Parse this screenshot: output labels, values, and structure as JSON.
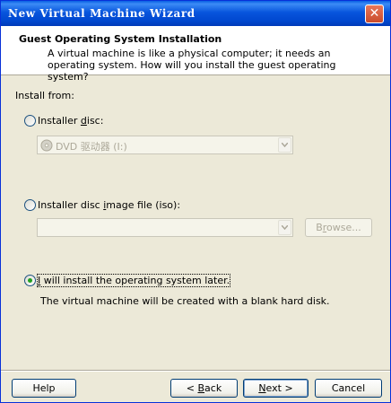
{
  "window": {
    "title": "New Virtual Machine Wizard",
    "close_glyph": "✕"
  },
  "header": {
    "title": "Guest Operating System Installation",
    "description": "A virtual machine is like a physical computer; it needs an operating system. How will you install the guest operating system?"
  },
  "install_from": {
    "label": "Install from:",
    "options": [
      {
        "label_pre": "Installer ",
        "label_key": "d",
        "label_post": "isc:",
        "selected": false,
        "combo_value": "DVD 驱动器 (I:)",
        "combo_icon": "dvd-drive-icon"
      },
      {
        "label_pre": "Installer disc ",
        "label_key": "i",
        "label_post": "mage file (iso):",
        "selected": false,
        "combo_value": "",
        "browse_pre": "B",
        "browse_key": "r",
        "browse_post": "owse..."
      },
      {
        "label_pre": "",
        "label_key": "I",
        "label_post": " will install the operating system later.",
        "selected": true,
        "info": "The virtual machine will be created with a blank hard disk."
      }
    ]
  },
  "buttons": {
    "help": "Help",
    "back_pre": "< ",
    "back_key": "B",
    "back_post": "ack",
    "next_key": "N",
    "next_post": "ext >",
    "cancel": "Cancel"
  },
  "colors": {
    "titlebar": "#0855dd",
    "radio_dot": "#21a121",
    "dialog_bg": "#ece9d8"
  }
}
